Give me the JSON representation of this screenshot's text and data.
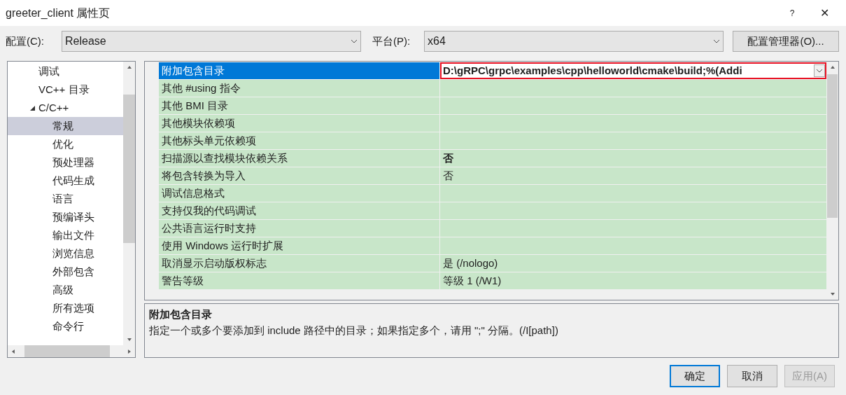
{
  "window": {
    "title": "greeter_client 属性页",
    "help": "?",
    "close": "✕"
  },
  "toolbar": {
    "config_label": "配置(C):",
    "config_value": "Release",
    "platform_label": "平台(P):",
    "platform_value": "x64",
    "manager_button": "配置管理器(O)..."
  },
  "sidebar": {
    "items": [
      {
        "label": "调试",
        "selected": false
      },
      {
        "label": "VC++ 目录",
        "selected": false
      },
      {
        "label": "C/C++",
        "selected": false,
        "expanded": true,
        "children": [
          {
            "label": "常规",
            "selected": true
          },
          {
            "label": "优化",
            "selected": false
          },
          {
            "label": "预处理器",
            "selected": false
          },
          {
            "label": "代码生成",
            "selected": false
          },
          {
            "label": "语言",
            "selected": false
          },
          {
            "label": "预编译头",
            "selected": false
          },
          {
            "label": "输出文件",
            "selected": false
          },
          {
            "label": "浏览信息",
            "selected": false
          },
          {
            "label": "外部包含",
            "selected": false
          },
          {
            "label": "高级",
            "selected": false
          },
          {
            "label": "所有选项",
            "selected": false
          },
          {
            "label": "命令行",
            "selected": false
          }
        ]
      }
    ]
  },
  "properties": [
    {
      "name": "附加包含目录",
      "value": "D:\\gRPC\\grpc\\examples\\cpp\\helloworld\\cmake\\build;%(Addi",
      "bold": true,
      "selected": true,
      "highlighted": true
    },
    {
      "name": "其他 #using 指令",
      "bold": false,
      "selected": false,
      "highlighted": false
    },
    {
      "name": "其他 BMI 目录",
      "bold": false,
      "selected": false,
      "highlighted": false
    },
    {
      "name": "其他模块依赖项",
      "bold": false,
      "selected": false,
      "highlighted": false
    },
    {
      "name": "其他标头单元依赖项",
      "bold": false,
      "selected": false,
      "highlighted": false
    },
    {
      "name": "扫描源以查找模块依赖关系",
      "value": "否",
      "bold": true,
      "selected": false,
      "highlighted": false
    },
    {
      "name": "将包含转换为导入",
      "value": "否",
      "bold": false,
      "selected": false,
      "highlighted": false
    },
    {
      "name": "调试信息格式",
      "bold": false,
      "selected": false,
      "highlighted": false
    },
    {
      "name": "支持仅我的代码调试",
      "bold": false,
      "selected": false,
      "highlighted": false
    },
    {
      "name": "公共语言运行时支持",
      "bold": false,
      "selected": false,
      "highlighted": false
    },
    {
      "name": "使用 Windows 运行时扩展",
      "bold": false,
      "selected": false,
      "highlighted": false
    },
    {
      "name": "取消显示启动版权标志",
      "value": "是 (/nologo)",
      "bold": false,
      "selected": false,
      "highlighted": false
    },
    {
      "name": "警告等级",
      "value": "等级 1 (/W1)",
      "bold": false,
      "selected": false,
      "highlighted": false
    }
  ],
  "description": {
    "title": "附加包含目录",
    "text": "指定一个或多个要添加到 include 路径中的目录；如果指定多个，请用 \";\" 分隔。(/I[path])"
  },
  "buttons": [
    {
      "label": "确定",
      "disabled": false,
      "default": true
    },
    {
      "label": "取消",
      "disabled": false,
      "default": false
    },
    {
      "label": "应用(A)",
      "disabled": true,
      "default": false
    }
  ]
}
